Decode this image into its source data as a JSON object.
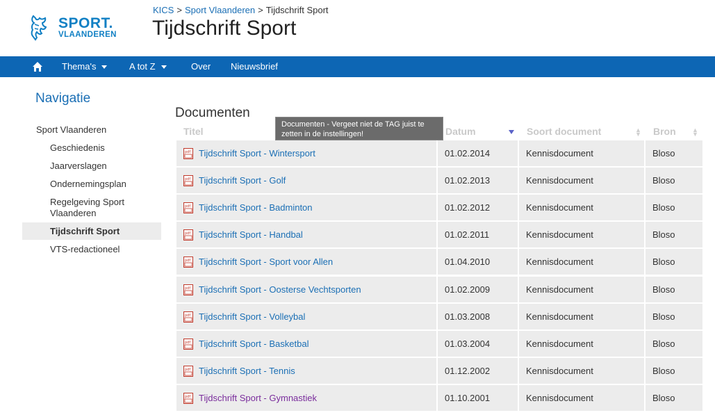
{
  "breadcrumb": {
    "items": [
      "KICS",
      "Sport Vlaanderen",
      "Tijdschrift Sport"
    ],
    "separator": ">"
  },
  "page_title": "Tijdschrift Sport",
  "logo": {
    "line1": "SPORT.",
    "line2": "VLAANDEREN"
  },
  "navbar": {
    "home_icon": "home-icon",
    "items": [
      "Thema's",
      "A tot Z",
      "Over",
      "Nieuwsbrief"
    ]
  },
  "sidebar": {
    "title": "Navigatie",
    "root": "Sport Vlaanderen",
    "items": [
      "Geschiedenis",
      "Jaarverslagen",
      "Ondernemingsplan",
      "Regelgeving Sport Vlaanderen",
      "Tijdschrift Sport",
      "VTS-redactioneel"
    ],
    "active": "Tijdschrift Sport"
  },
  "content": {
    "title": "Documenten",
    "tooltip": "Documenten - Vergeet niet de TAG juist te zetten in de instellingen!",
    "columns": [
      "Titel",
      "Datum",
      "Soort document",
      "Bron"
    ],
    "rows": [
      {
        "title": "Tijdschrift Sport - Wintersport",
        "date": "01.02.2014",
        "kind": "Kennisdocument",
        "source": "Bloso"
      },
      {
        "title": "Tijdschrift Sport - Golf",
        "date": "01.02.2013",
        "kind": "Kennisdocument",
        "source": "Bloso"
      },
      {
        "title": "Tijdschrift Sport - Badminton",
        "date": "01.02.2012",
        "kind": "Kennisdocument",
        "source": "Bloso"
      },
      {
        "title": "Tijdschrift Sport - Handbal",
        "date": "01.02.2011",
        "kind": "Kennisdocument",
        "source": "Bloso"
      },
      {
        "title": "Tijdschrift Sport - Sport voor Allen",
        "date": "01.04.2010",
        "kind": "Kennisdocument",
        "source": "Bloso"
      },
      {
        "title": "Tijdschrift Sport - Oosterse Vechtsporten",
        "date": "01.02.2009",
        "kind": "Kennisdocument",
        "source": "Bloso"
      },
      {
        "title": "Tijdschrift Sport - Volleybal",
        "date": "01.03.2008",
        "kind": "Kennisdocument",
        "source": "Bloso"
      },
      {
        "title": "Tijdschrift Sport - Basketbal",
        "date": "01.03.2004",
        "kind": "Kennisdocument",
        "source": "Bloso"
      },
      {
        "title": "Tijdschrift Sport - Tennis",
        "date": "01.12.2002",
        "kind": "Kennisdocument",
        "source": "Bloso"
      },
      {
        "title": "Tijdschrift Sport - Gymnastiek",
        "date": "01.10.2001",
        "kind": "Kennisdocument",
        "source": "Bloso",
        "visited": true
      }
    ]
  },
  "colors": {
    "nav_bg": "#0d66b4",
    "link": "#1b6fb5",
    "visited_link": "#7a2d9c",
    "row_bg": "#ececec",
    "brand": "#1180c4"
  }
}
